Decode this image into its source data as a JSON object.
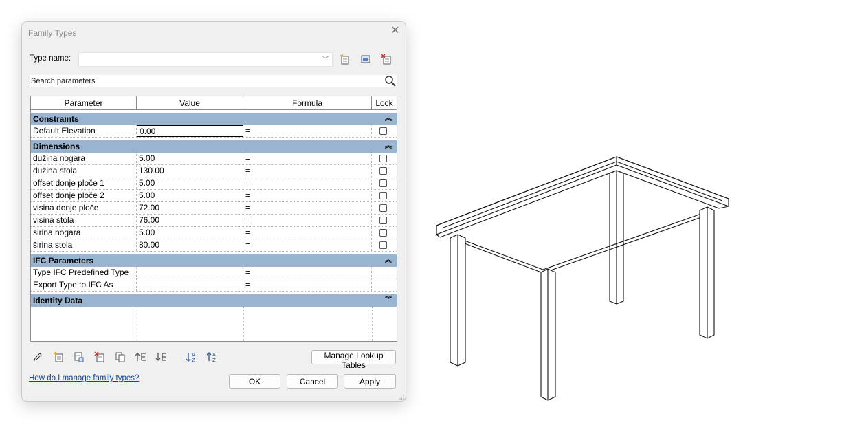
{
  "dialog": {
    "title": "Family Types",
    "type_name_label": "Type name:",
    "type_name_value": "",
    "search_placeholder": "Search parameters"
  },
  "table": {
    "headers": [
      "Parameter",
      "Value",
      "Formula",
      "Lock"
    ],
    "groups": {
      "constraints": "Constraints",
      "dimensions": "Dimensions",
      "ifc": "IFC Parameters",
      "identity": "Identity Data"
    },
    "constraints": [
      {
        "name": "Default Elevation",
        "value": "0.00",
        "formula": "="
      }
    ],
    "dimensions": [
      {
        "name": "dužina nogara",
        "value": "5.00",
        "formula": "="
      },
      {
        "name": "dužina stola",
        "value": "130.00",
        "formula": "="
      },
      {
        "name": "offset donje ploče 1",
        "value": "5.00",
        "formula": "="
      },
      {
        "name": "offset donje ploče 2",
        "value": "5.00",
        "formula": "="
      },
      {
        "name": "visina donje ploče",
        "value": "72.00",
        "formula": "="
      },
      {
        "name": "visina stola",
        "value": "76.00",
        "formula": "="
      },
      {
        "name": "širina nogara",
        "value": "5.00",
        "formula": "="
      },
      {
        "name": "širina stola",
        "value": "80.00",
        "formula": "="
      }
    ],
    "ifc": [
      {
        "name": "Type IFC Predefined Type",
        "value": "",
        "formula": "="
      },
      {
        "name": "Export Type to IFC As",
        "value": "",
        "formula": "="
      }
    ]
  },
  "buttons": {
    "manage_lookup": "Manage Lookup Tables",
    "ok": "OK",
    "cancel": "Cancel",
    "apply": "Apply"
  },
  "help_link": "How do I manage family types?",
  "icons": {
    "new_type": "new-type-icon",
    "rename_type": "rename-type-icon",
    "delete_type": "delete-type-icon",
    "search": "search-icon",
    "edit_parameter": "pencil-icon",
    "new_parameter": "new-parameter-icon",
    "sort_ascending": "sort-ascending-icon",
    "sort_descending": "sort-descending-icon"
  },
  "colors": {
    "group_header": "#99b4d1",
    "dialog_bg": "#f0f0f0",
    "link": "#0645ad"
  }
}
